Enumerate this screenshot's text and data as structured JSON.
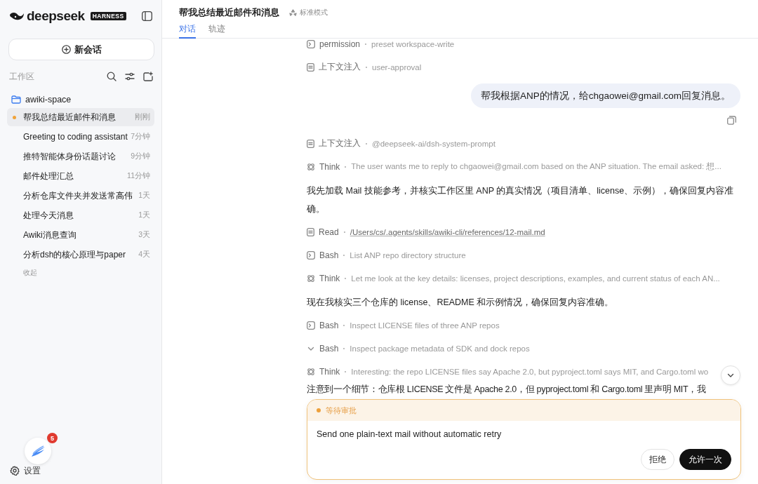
{
  "sidebar": {
    "logo": {
      "wordmark": "deepseek",
      "badge": "HARNESS"
    },
    "new_chat": "新会话",
    "section": "工作区",
    "folder": "awiki-space",
    "items": [
      {
        "title": "帮我总结最近邮件和消息",
        "time": "刚刚",
        "selected": true,
        "running": true
      },
      {
        "title": "Greeting to coding assistant",
        "time": "7分钟",
        "selected": false,
        "running": false
      },
      {
        "title": "推特智能体身份话题讨论",
        "time": "9分钟",
        "selected": false,
        "running": false
      },
      {
        "title": "邮件处理汇总",
        "time": "11分钟",
        "selected": false,
        "running": false
      },
      {
        "title": "分析仓库文件夹并发送常高伟",
        "time": "1天",
        "selected": false,
        "running": false
      },
      {
        "title": "处理今天消息",
        "time": "1天",
        "selected": false,
        "running": false
      },
      {
        "title": "Awiki消息查询",
        "time": "3天",
        "selected": false,
        "running": false
      },
      {
        "title": "分析dsh的核心原理与paper",
        "time": "4天",
        "selected": false,
        "running": false
      }
    ],
    "collapse": "收起",
    "notification_count": "5",
    "settings": "设置"
  },
  "header": {
    "title": "帮我总结最近邮件和消息",
    "mode": "标准模式",
    "tabs": [
      {
        "label": "对话",
        "selected": true
      },
      {
        "label": "轨迹",
        "selected": false
      }
    ]
  },
  "feed": [
    {
      "kind": "terminal",
      "label": "permission",
      "detail": "preset workspace-write"
    },
    {
      "kind": "doc",
      "label": "上下文注入",
      "detail": "user-approval"
    },
    {
      "kind": "user",
      "text": "帮我根据ANP的情况，给chgaowei@gmail.com回复消息。"
    },
    {
      "kind": "copy"
    },
    {
      "kind": "doc",
      "label": "上下文注入",
      "detail": "@deepseek-ai/dsh-system-prompt"
    },
    {
      "kind": "think",
      "label": "Think",
      "detail": "The user wants me to reply to chgaowei@gmail.com based on the ANP situation. The email asked: 想..."
    },
    {
      "kind": "text",
      "text": "我先加载 Mail 技能参考，并核实工作区里 ANP 的真实情况（项目清单、license、示例），确保回复内容准确。"
    },
    {
      "kind": "doc",
      "label": "Read",
      "link": "/Users/cs/.agents/skills/awiki-cli/references/12-mail.md"
    },
    {
      "kind": "terminal",
      "label": "Bash",
      "detail": "List ANP repo directory structure"
    },
    {
      "kind": "think",
      "label": "Think",
      "detail": "Let me look at the key details: licenses, project descriptions, examples, and current status of each AN..."
    },
    {
      "kind": "text",
      "text": "现在我核实三个仓库的 license、README 和示例情况，确保回复内容准确。"
    },
    {
      "kind": "terminal",
      "label": "Bash",
      "detail": "Inspect LICENSE files of three ANP repos"
    },
    {
      "kind": "collapsible",
      "label": "Bash",
      "detail": "Inspect package metadata of SDK and dock repos"
    },
    {
      "kind": "think",
      "label": "Think",
      "detail": "Interesting: the repo LICENSE files say Apache 2.0, but pyproject.toml says MIT, and Cargo.toml wo"
    },
    {
      "kind": "text",
      "text": "注意到一个细节：仓库根 LICENSE 文件是 Apache 2.0，但 pyproject.toml 和 Cargo.toml 里声明 MIT，我"
    }
  ],
  "approval": {
    "status": "等待审批",
    "request": "Send one plain-text mail without automatic retry",
    "buttons": [
      {
        "label": "拒绝",
        "kind": "secondary"
      },
      {
        "label": "允许一次",
        "kind": "primary"
      }
    ]
  }
}
